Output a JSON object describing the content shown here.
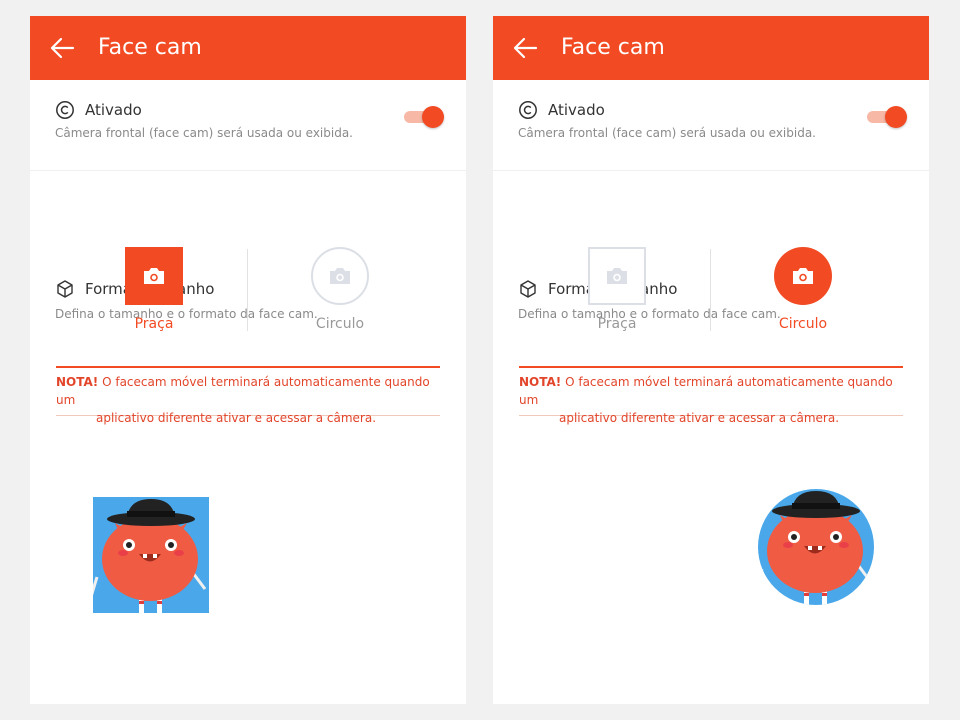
{
  "screens": [
    {
      "header": {
        "title": "Face cam"
      },
      "activated": {
        "title": "Ativado",
        "subtitle": "Câmera frontal (face cam) será usada ou exibida.",
        "enabled": true
      },
      "shape": {
        "title": "Forma / Tamanho",
        "subtitle": "Defina o tamanho e o formato da face cam.",
        "options": [
          {
            "label": "Praça",
            "selected": true
          },
          {
            "label": "Circulo",
            "selected": false
          }
        ]
      },
      "note": {
        "label": "NOTA!",
        "line1": "O facecam móvel terminará automaticamente quando um",
        "line2": "aplicativo diferente ativar e acessar a câmera."
      }
    },
    {
      "header": {
        "title": "Face cam"
      },
      "activated": {
        "title": "Ativado",
        "subtitle": "Câmera frontal (face cam) será usada ou exibida.",
        "enabled": true
      },
      "shape": {
        "title": "Forma / Tamanho",
        "subtitle": "Defina o tamanho e o formato da face cam.",
        "options": [
          {
            "label": "Praça",
            "selected": false
          },
          {
            "label": "Circulo",
            "selected": true
          }
        ]
      },
      "note": {
        "label": "NOTA!",
        "line1": "O facecam móvel terminará automaticamente quando um",
        "line2": "aplicativo diferente ativar e acessar a câmera."
      }
    }
  ],
  "colors": {
    "accent": "#f24b24",
    "note_text": "#e2452a",
    "avatar_bg": "#4aa8ea"
  },
  "icons": {
    "back": "arrow-left-icon",
    "activated": "copyright-circle-icon",
    "shape": "cube-icon",
    "camera": "camera-icon"
  }
}
